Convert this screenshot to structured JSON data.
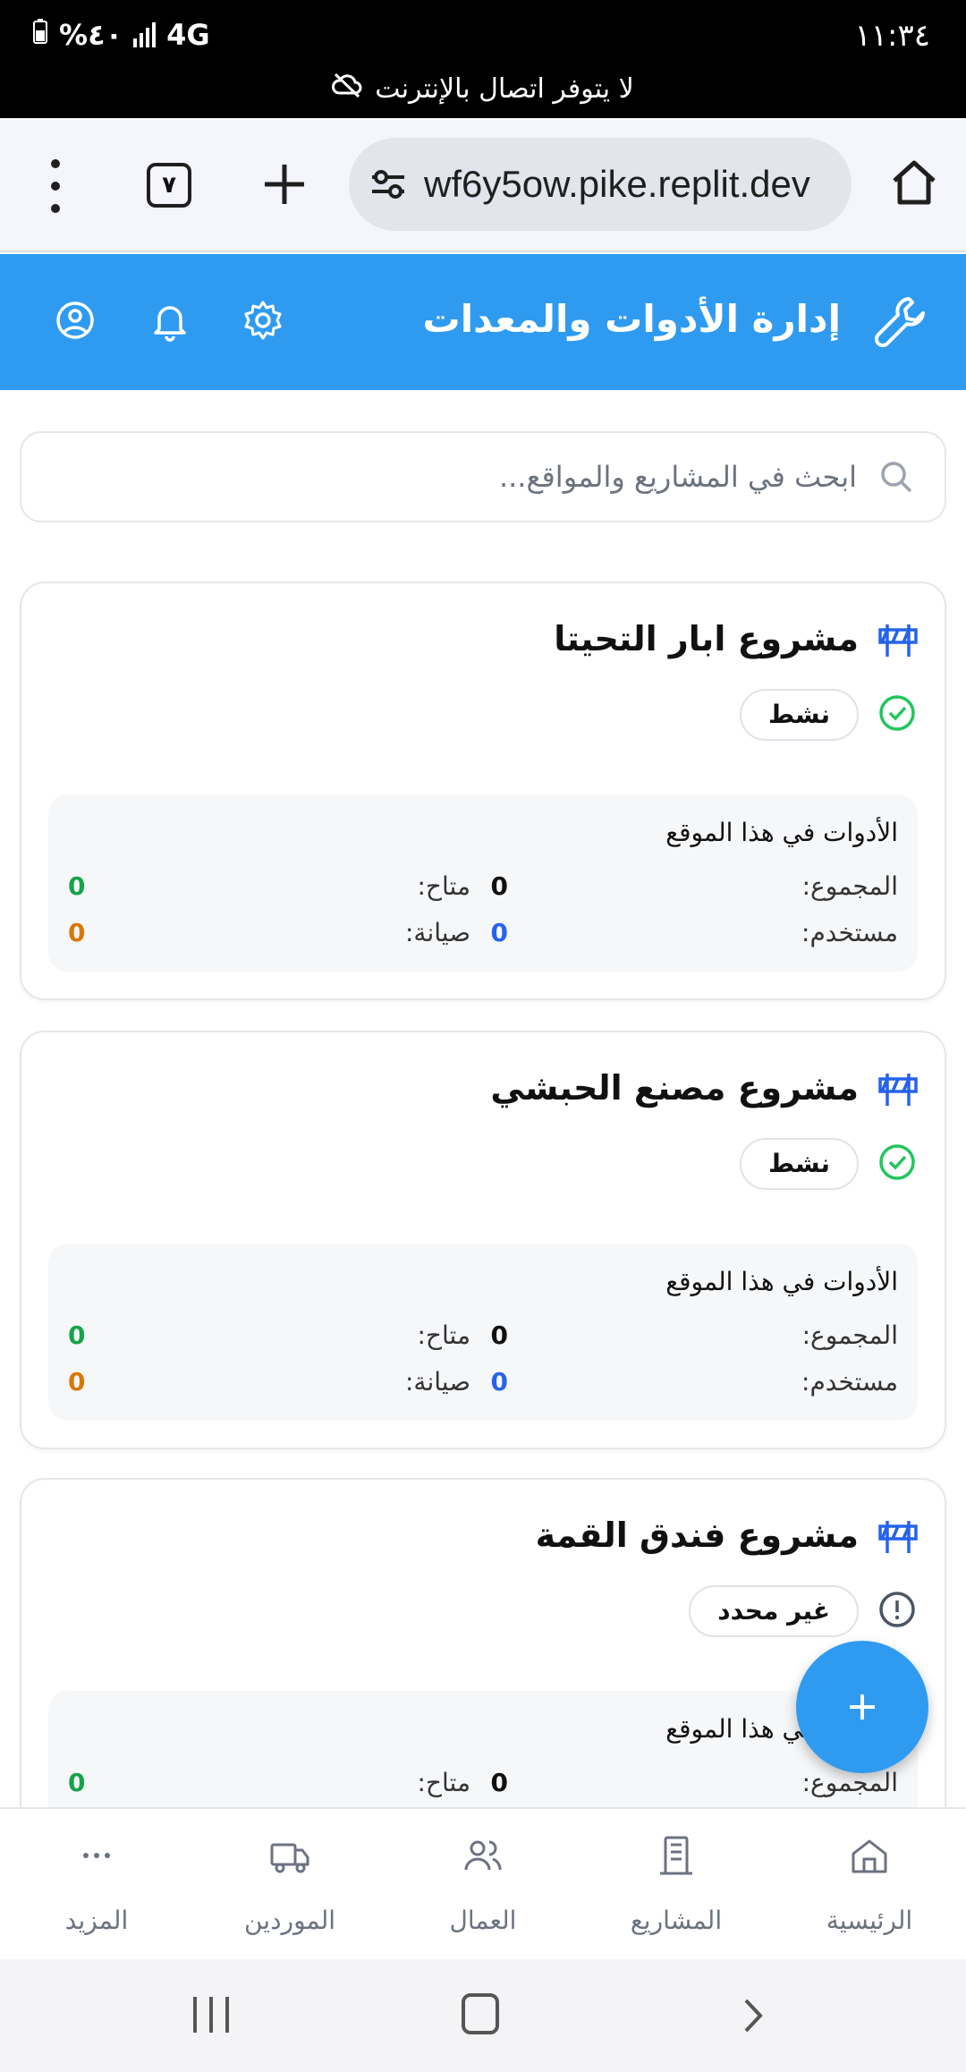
{
  "status_bar": {
    "time": "١١:٣٤",
    "battery": "%٤٠",
    "network": "4G",
    "offline_message": "لا يتوفر اتصال بالإنترنت"
  },
  "browser": {
    "url": "wf6y5ow.pike.replit.dev",
    "tab_count": "٧"
  },
  "header": {
    "title": "إدارة الأدوات والمعدات"
  },
  "search": {
    "placeholder": "ابحث في المشاريع والمواقع..."
  },
  "projects": [
    {
      "name": "مشروع ابار التحيتا",
      "status": "نشط",
      "status_type": "active",
      "tools_heading": "الأدوات في هذا الموقع",
      "total_label": "المجموع:",
      "total": "0",
      "available_label": "متاح:",
      "available": "0",
      "used_label": "مستخدم:",
      "used": "0",
      "maintenance_label": "صيانة:",
      "maintenance": "0"
    },
    {
      "name": "مشروع مصنع الحبشي",
      "status": "نشط",
      "status_type": "active",
      "tools_heading": "الأدوات في هذا الموقع",
      "total_label": "المجموع:",
      "total": "0",
      "available_label": "متاح:",
      "available": "0",
      "used_label": "مستخدم:",
      "used": "0",
      "maintenance_label": "صيانة:",
      "maintenance": "0"
    },
    {
      "name": "مشروع فندق القمة",
      "status": "غير محدد",
      "status_type": "undefined",
      "tools_heading": "الأدوات في هذا الموقع",
      "total_label": "المجموع:",
      "total": "0",
      "available_label": "متاح:",
      "available": "0"
    }
  ],
  "bottom_nav": [
    {
      "label": "الرئيسية",
      "icon": "home-icon"
    },
    {
      "label": "المشاريع",
      "icon": "building-icon"
    },
    {
      "label": "العمال",
      "icon": "users-icon"
    },
    {
      "label": "الموردين",
      "icon": "truck-icon"
    },
    {
      "label": "المزيد",
      "icon": "more-icon"
    }
  ],
  "colors": {
    "primary": "#2f9bf0",
    "success": "#16a34a",
    "warning": "#d97706",
    "info": "#2563eb"
  }
}
